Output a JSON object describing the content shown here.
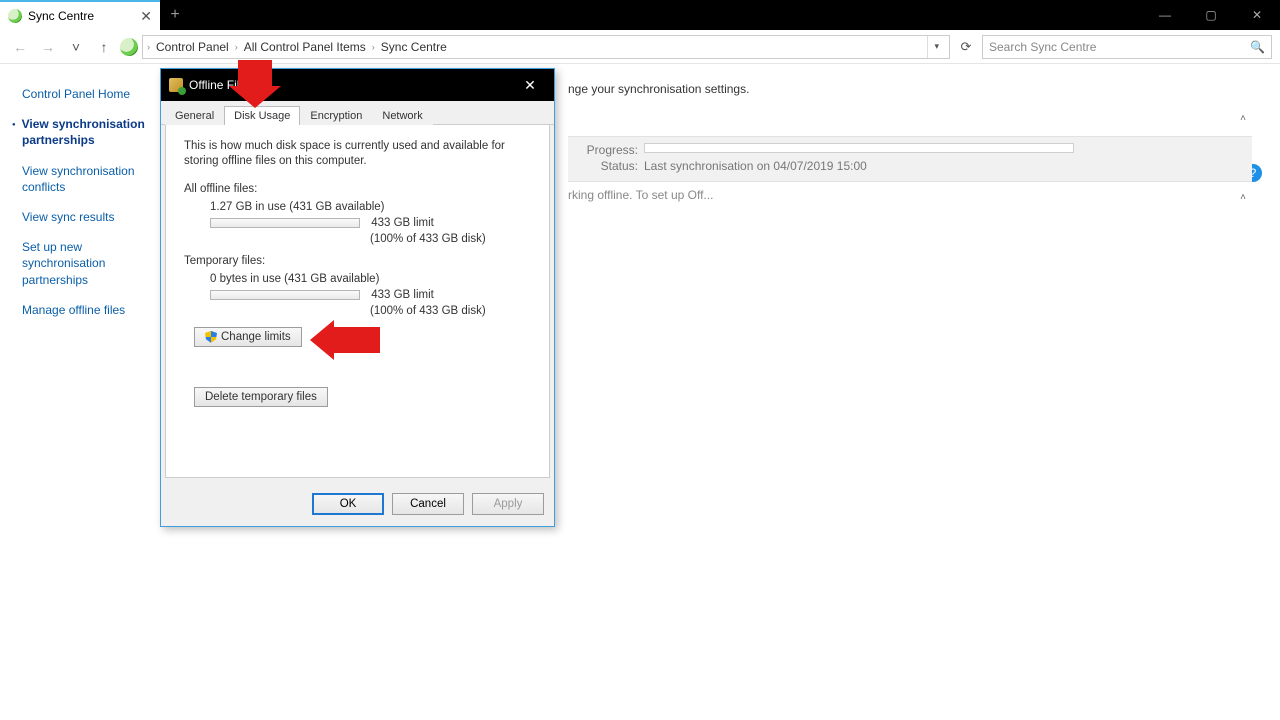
{
  "window": {
    "tab_title": "Sync Centre"
  },
  "wincontrols": {
    "min": "—",
    "max": "▢",
    "close": "✕"
  },
  "nav": {
    "back": "←",
    "fwd": "→",
    "up": "↑",
    "refresh": "⟳",
    "dropdown": "▾"
  },
  "breadcrumb": [
    "Control Panel",
    "All Control Panel Items",
    "Sync Centre"
  ],
  "search": {
    "placeholder": "Search Sync Centre"
  },
  "sidebar": {
    "items": [
      {
        "label": "Control Panel Home",
        "active": false
      },
      {
        "label": "View synchronisation partnerships",
        "active": true
      },
      {
        "label": "View synchronisation conflicts",
        "active": false
      },
      {
        "label": "View sync results",
        "active": false
      },
      {
        "label": "Set up new synchronisation partnerships",
        "active": false
      },
      {
        "label": "Manage offline files",
        "active": false
      }
    ]
  },
  "content": {
    "heading_fragment": "nge your synchronisation settings.",
    "offline_fragment": "rking offline. To set up Off...",
    "progress_label": "Progress:",
    "status_label": "Status:",
    "status_value": "Last synchronisation on 04/07/2019 15:00"
  },
  "dialog": {
    "title": "Offline Files",
    "tabs": [
      "General",
      "Disk Usage",
      "Encryption",
      "Network"
    ],
    "active_tab": 1,
    "desc": "This is how much disk space is currently used and available for storing offline files on this computer.",
    "all_head": "All offline files:",
    "all_usage": "1.27 GB in use (431 GB available)",
    "all_limit": "433 GB limit",
    "all_pct": "(100% of 433 GB disk)",
    "temp_head": "Temporary files:",
    "temp_usage": "0 bytes in use (431 GB available)",
    "temp_limit": "433 GB limit",
    "temp_pct": "(100% of 433 GB disk)",
    "change_limits": "Change limits",
    "delete_temp": "Delete temporary files",
    "ok": "OK",
    "cancel": "Cancel",
    "apply": "Apply"
  }
}
